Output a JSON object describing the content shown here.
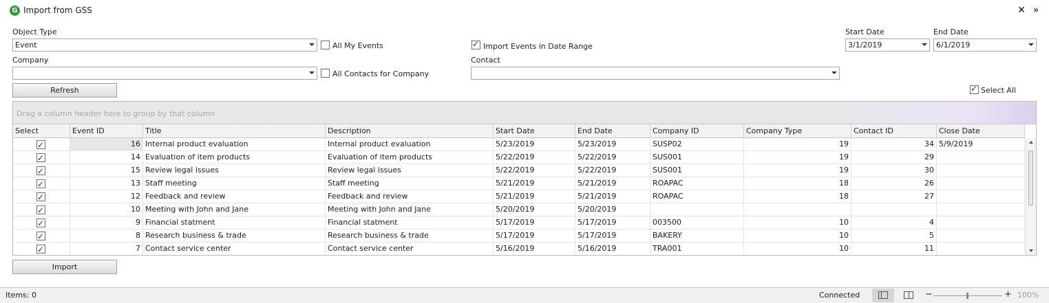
{
  "window": {
    "title": "Import from GSS"
  },
  "form": {
    "object_type_label": "Object Type",
    "object_type_value": "Event",
    "all_my_events_label": "All My Events",
    "all_my_events_checked": false,
    "import_in_range_label": "Import Events in Date Range",
    "import_in_range_checked": true,
    "start_date_label": "Start Date",
    "start_date_value": "3/1/2019",
    "end_date_label": "End Date",
    "end_date_value": "6/1/2019",
    "company_label": "Company",
    "company_value": "",
    "all_contacts_label": "All Contacts for Company",
    "all_contacts_checked": false,
    "contact_label": "Contact",
    "contact_value": "",
    "refresh_label": "Refresh",
    "select_all_label": "Select All",
    "select_all_checked": true,
    "import_label": "Import"
  },
  "grid": {
    "group_hint": "Drag a column header here to group by that column",
    "columns": [
      "Select",
      "Event ID",
      "Title",
      "Description",
      "Start Date",
      "End Date",
      "Company ID",
      "Company Type",
      "Contact ID",
      "Close Date"
    ],
    "rows": [
      {
        "selected": true,
        "event_id": "16",
        "title": "Internal product evaluation",
        "description": "Internal product evaluation",
        "start_date": "5/23/2019",
        "end_date": "5/23/2019",
        "company_id": "SUSP02",
        "company_type": "19",
        "contact_id": "34",
        "close_date": "5/9/2019"
      },
      {
        "selected": true,
        "event_id": "14",
        "title": "Evaluation of item products",
        "description": "Evaluation of item products",
        "start_date": "5/22/2019",
        "end_date": "5/22/2019",
        "company_id": "SUS001",
        "company_type": "19",
        "contact_id": "29",
        "close_date": ""
      },
      {
        "selected": true,
        "event_id": "15",
        "title": "Review legal issues",
        "description": "Review legal issues",
        "start_date": "5/22/2019",
        "end_date": "5/22/2019",
        "company_id": "SUS001",
        "company_type": "19",
        "contact_id": "30",
        "close_date": ""
      },
      {
        "selected": true,
        "event_id": "13",
        "title": "Staff meeting",
        "description": "Staff meeting",
        "start_date": "5/21/2019",
        "end_date": "5/21/2019",
        "company_id": "ROAPAC",
        "company_type": "18",
        "contact_id": "26",
        "close_date": ""
      },
      {
        "selected": true,
        "event_id": "12",
        "title": "Feedback and review",
        "description": "Feedback and review",
        "start_date": "5/21/2019",
        "end_date": "5/21/2019",
        "company_id": "ROAPAC",
        "company_type": "18",
        "contact_id": "27",
        "close_date": ""
      },
      {
        "selected": true,
        "event_id": "10",
        "title": "Meeting with John and Jane",
        "description": "Meeting with John and Jane",
        "start_date": "5/20/2019",
        "end_date": "5/20/2019",
        "company_id": "",
        "company_type": "",
        "contact_id": "",
        "close_date": ""
      },
      {
        "selected": true,
        "event_id": "9",
        "title": "Financial statment",
        "description": "Financial statment",
        "start_date": "5/17/2019",
        "end_date": "5/17/2019",
        "company_id": "003500",
        "company_type": "10",
        "contact_id": "4",
        "close_date": ""
      },
      {
        "selected": true,
        "event_id": "8",
        "title": "Research business & trade",
        "description": "Research business & trade",
        "start_date": "5/17/2019",
        "end_date": "5/17/2019",
        "company_id": "BAKERY",
        "company_type": "10",
        "contact_id": "5",
        "close_date": ""
      },
      {
        "selected": true,
        "event_id": "7",
        "title": "Contact service center",
        "description": "Contact service center",
        "start_date": "5/16/2019",
        "end_date": "5/16/2019",
        "company_id": "TRA001",
        "company_type": "10",
        "contact_id": "11",
        "close_date": ""
      }
    ]
  },
  "status": {
    "items": "Items: 0",
    "connection": "Connected",
    "zoom": "100%"
  }
}
